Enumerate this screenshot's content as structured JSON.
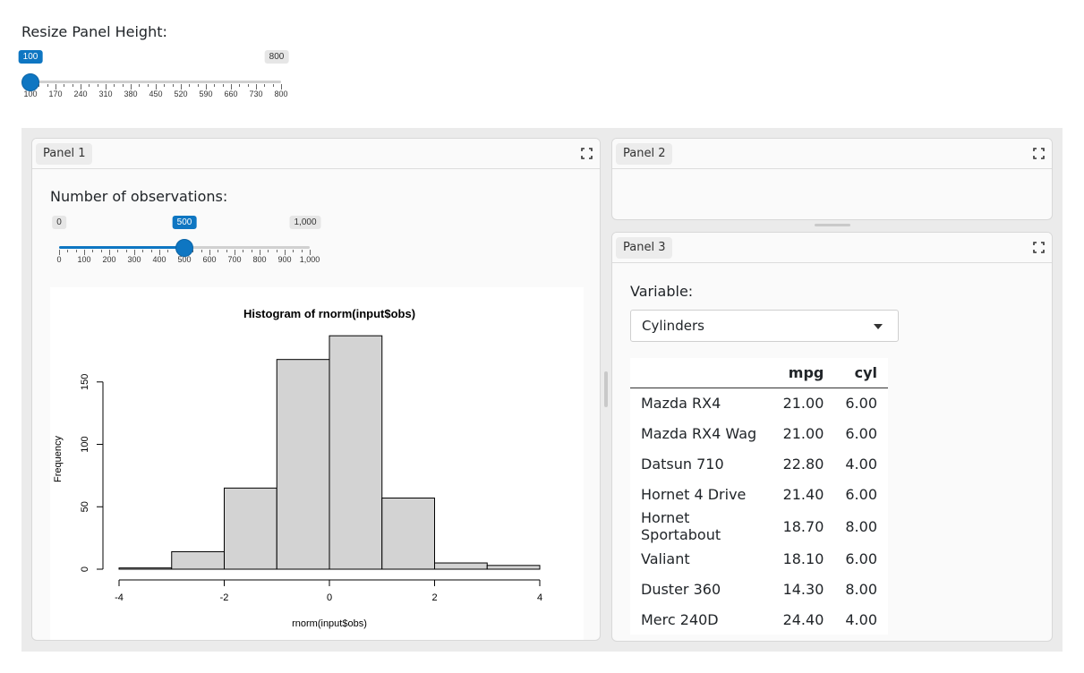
{
  "resize": {
    "label": "Resize Panel Height:",
    "min": 100,
    "max": 800,
    "value": 100,
    "min_label": "100",
    "max_label": "800",
    "value_label": "100",
    "ticks": [
      "100",
      "170",
      "240",
      "310",
      "380",
      "450",
      "520",
      "590",
      "660",
      "730",
      "800"
    ]
  },
  "panels": {
    "panel1": {
      "title": "Panel 1",
      "obs_label": "Number of observations:",
      "obs_slider": {
        "min": 0,
        "max": 1000,
        "value": 500,
        "min_label": "0",
        "max_label": "1,000",
        "value_label": "500",
        "ticks": [
          "0",
          "100",
          "200",
          "300",
          "400",
          "500",
          "600",
          "700",
          "800",
          "900",
          "1,000"
        ]
      }
    },
    "panel2": {
      "title": "Panel 2"
    },
    "panel3": {
      "title": "Panel 3",
      "variable_label": "Variable:",
      "selected": "Cylinders",
      "table": {
        "columns": [
          "",
          "mpg",
          "cyl"
        ],
        "rows": [
          [
            "Mazda RX4",
            "21.00",
            "6.00"
          ],
          [
            "Mazda RX4 Wag",
            "21.00",
            "6.00"
          ],
          [
            "Datsun 710",
            "22.80",
            "4.00"
          ],
          [
            "Hornet 4 Drive",
            "21.40",
            "6.00"
          ],
          [
            "Hornet Sportabout",
            "18.70",
            "8.00"
          ],
          [
            "Valiant",
            "18.10",
            "6.00"
          ],
          [
            "Duster 360",
            "14.30",
            "8.00"
          ],
          [
            "Merc 240D",
            "24.40",
            "4.00"
          ]
        ]
      }
    }
  },
  "chart_data": {
    "type": "bar",
    "title": "Histogram of rnorm(input$obs)",
    "xlabel": "rnorm(input$obs)",
    "ylabel": "Frequency",
    "bins": [
      [
        -4,
        -3
      ],
      [
        -3,
        -2
      ],
      [
        -2,
        -1
      ],
      [
        -1,
        0
      ],
      [
        0,
        1
      ],
      [
        1,
        2
      ],
      [
        2,
        3
      ],
      [
        3,
        4
      ]
    ],
    "values": [
      1,
      14,
      65,
      168,
      187,
      57,
      5,
      3
    ],
    "xticks": [
      -4,
      -2,
      0,
      2,
      4
    ],
    "yticks": [
      0,
      50,
      100,
      150
    ],
    "xlim": [
      -4,
      4
    ],
    "ylim": [
      0,
      190
    ],
    "bar_color": "#d3d3d3",
    "grid": false
  }
}
